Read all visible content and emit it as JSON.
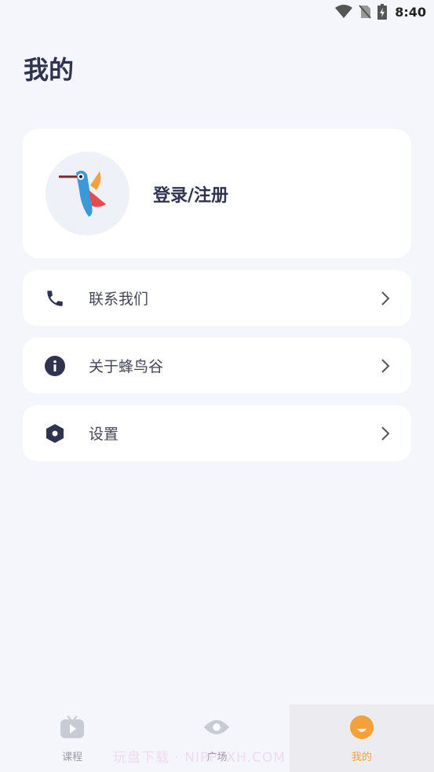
{
  "status_bar": {
    "time": "8:40"
  },
  "page": {
    "title": "我的"
  },
  "profile": {
    "login_label": "登录/注册"
  },
  "menu": [
    {
      "label": "联系我们",
      "icon": "phone-icon"
    },
    {
      "label": "关于蜂鸟谷",
      "icon": "info-icon"
    },
    {
      "label": "设置",
      "icon": "settings-icon"
    }
  ],
  "bottom_nav": [
    {
      "label": "课程",
      "icon": "tv-icon",
      "active": false
    },
    {
      "label": "广场",
      "icon": "eye-icon",
      "active": false
    },
    {
      "label": "我的",
      "icon": "smile-icon",
      "active": true
    }
  ],
  "colors": {
    "accent": "#f5a03b",
    "text_dark": "#2f3350",
    "background": "#f5f6fb"
  },
  "watermark": "玩盘下载 · NIPPYXH.COM"
}
